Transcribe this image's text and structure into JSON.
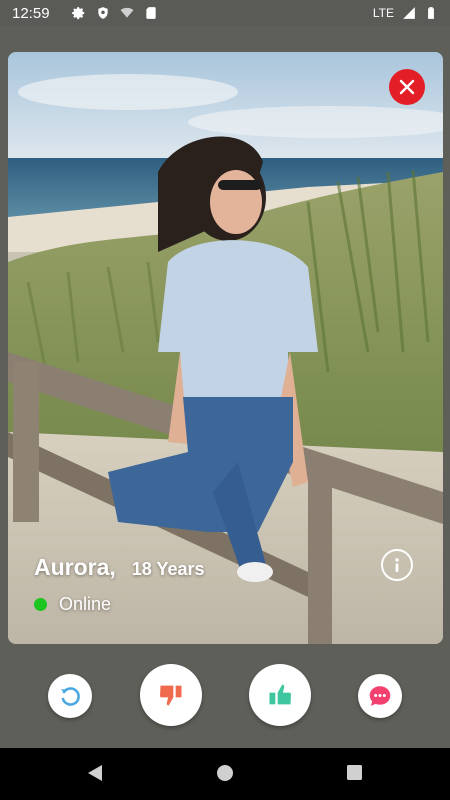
{
  "status_bar": {
    "time": "12:59",
    "network": "LTE",
    "icons": [
      "gear-icon",
      "shield-icon",
      "wifi-icon",
      "sd-card-icon",
      "signal-icon",
      "battery-icon"
    ]
  },
  "profile": {
    "name": "Aurora,",
    "age": "18 Years",
    "status": "Online",
    "status_color": "#1cc51f"
  },
  "actions": {
    "undo": "undo-icon",
    "dislike": "thumbs-down-icon",
    "like": "thumbs-up-icon",
    "chat": "chat-icon"
  },
  "colors": {
    "close": "#e41e26",
    "undo": "#4aa9e0",
    "dislike": "#f06a4e",
    "like": "#3ec6a0",
    "chat": "#f2416e"
  },
  "nav": [
    "back-icon",
    "home-icon",
    "recents-icon"
  ]
}
